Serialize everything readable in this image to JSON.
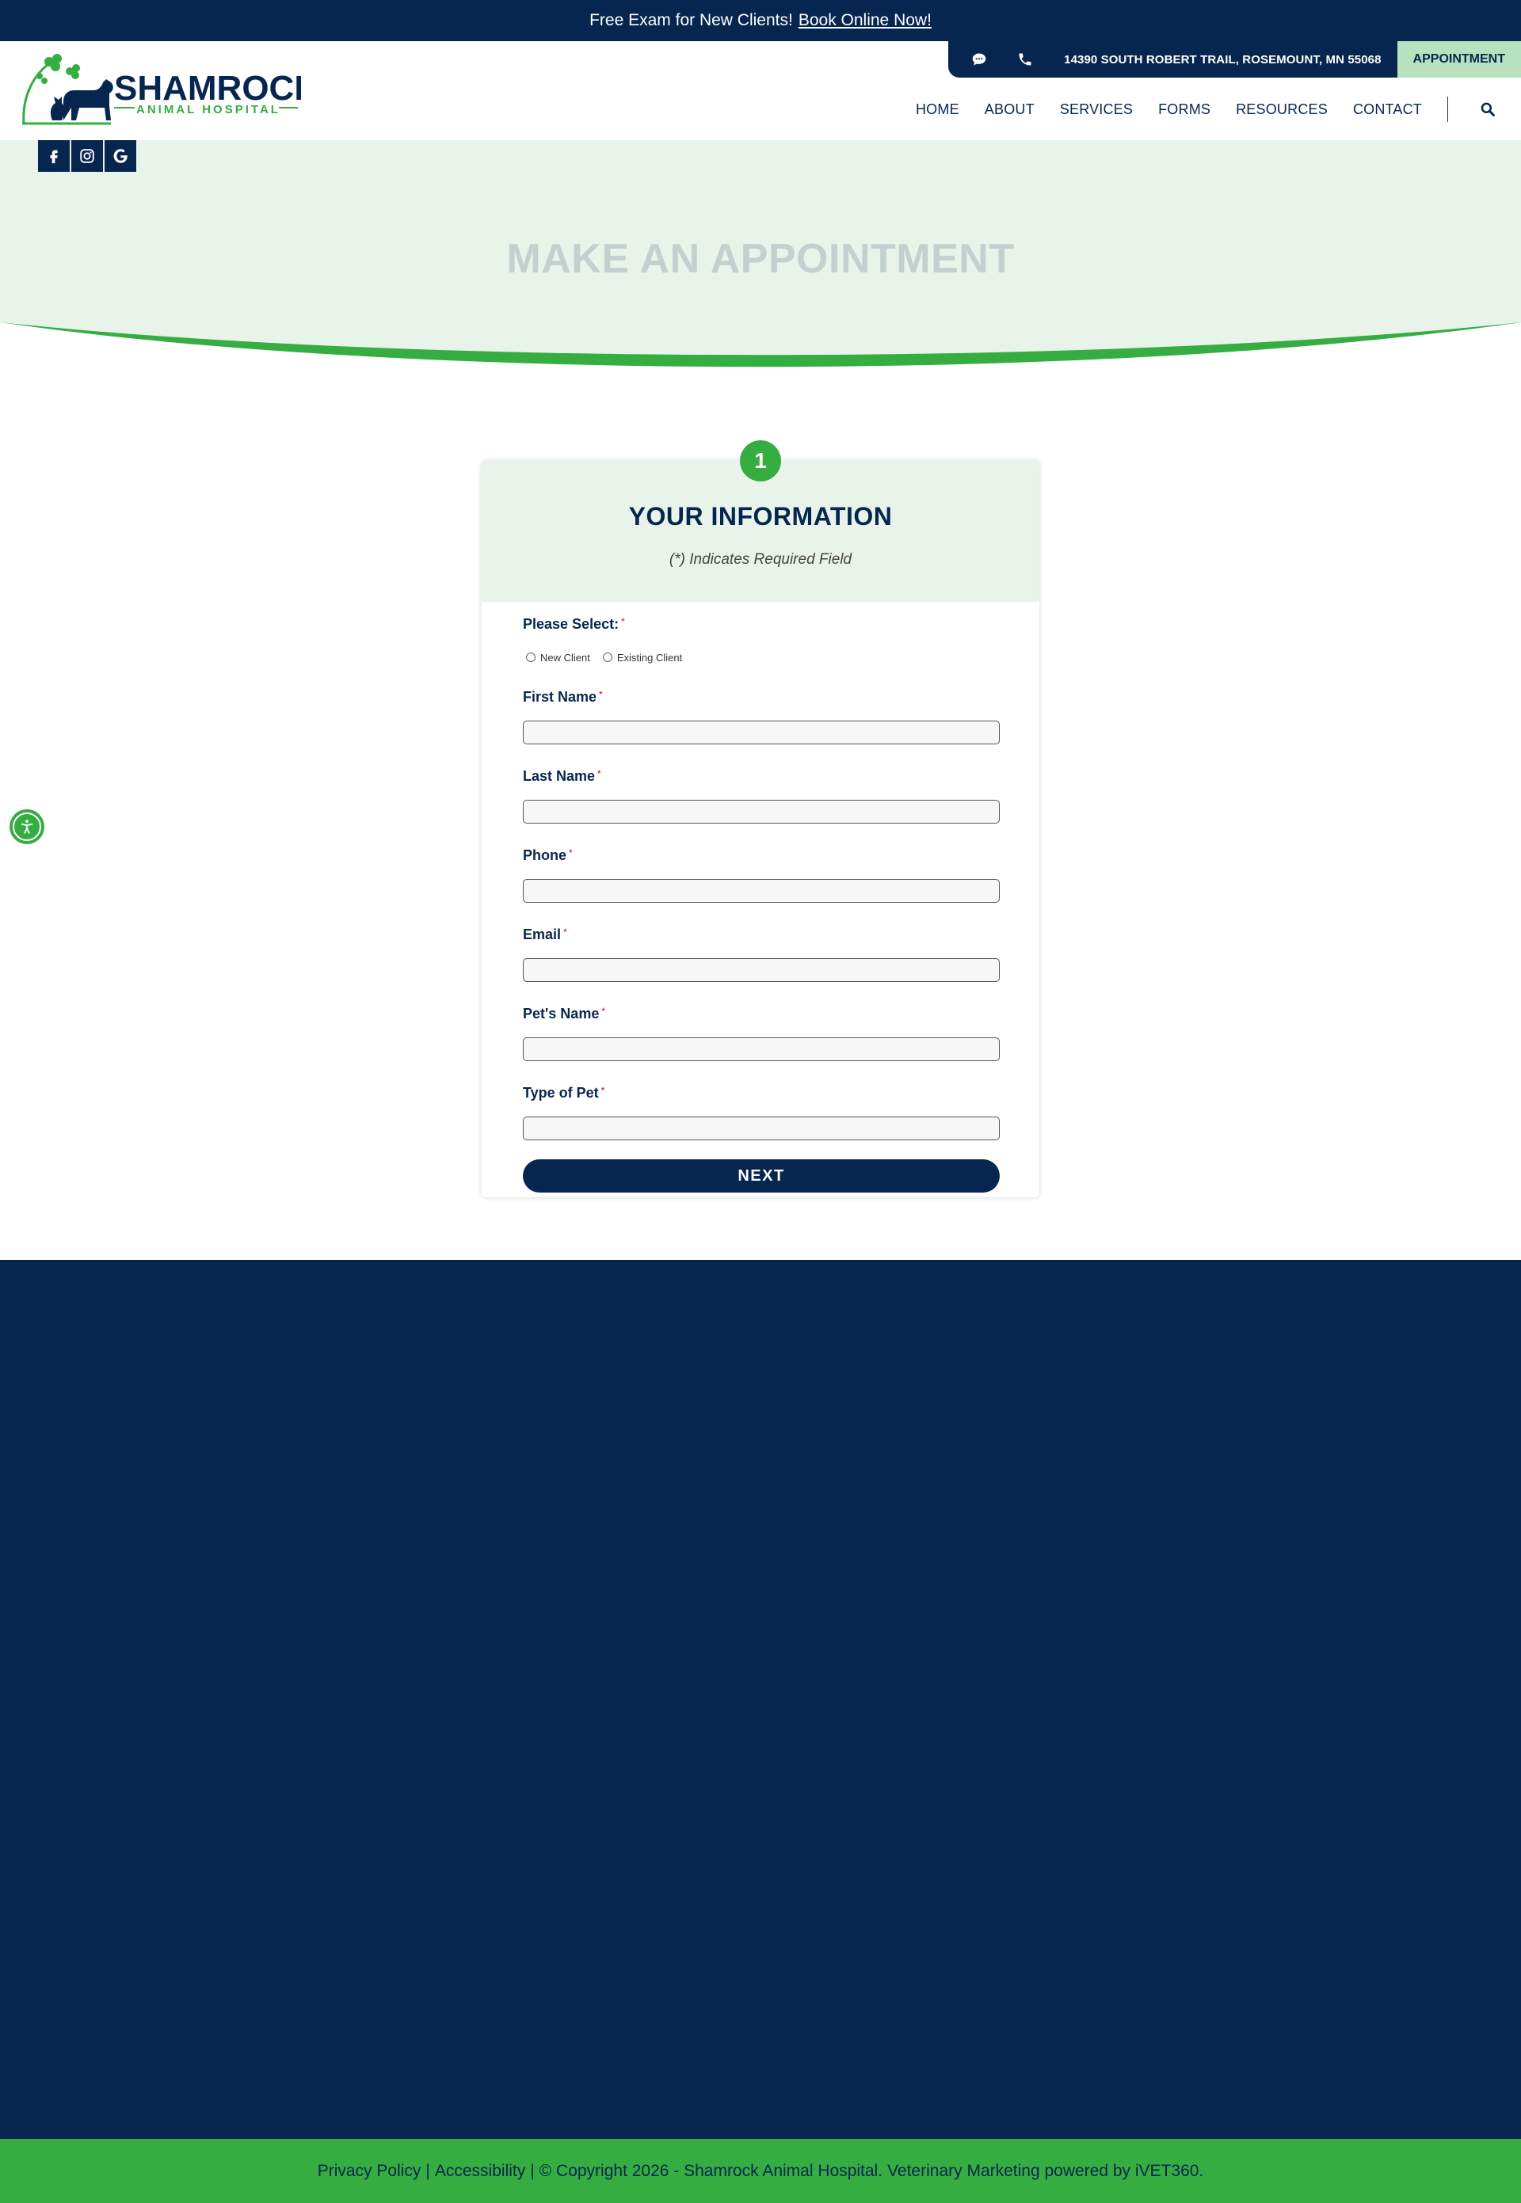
{
  "announcement": {
    "text": "Free Exam for New Clients!",
    "link": "Book Online Now!"
  },
  "header": {
    "logo": {
      "name": "SHAMROCK",
      "tagline": "ANIMAL HOSPITAL"
    },
    "topbar": {
      "chat_icon": "chat-bubble-icon",
      "phone_icon": "phone-icon",
      "address": "14390 SOUTH ROBERT TRAIL, ROSEMOUNT, MN 55068",
      "appointment": "APPOINTMENT"
    },
    "nav": [
      "HOME",
      "ABOUT",
      "SERVICES",
      "FORMS",
      "RESOURCES",
      "CONTACT"
    ],
    "search_icon": "search-icon"
  },
  "social": [
    "facebook-icon",
    "instagram-icon",
    "google-icon"
  ],
  "hero": {
    "title": "MAKE AN APPOINTMENT"
  },
  "form": {
    "step": "1",
    "title": "YOUR INFORMATION",
    "required_note": "(*) Indicates Required Field",
    "client_type": {
      "label": "Please Select:",
      "options": [
        "New Client",
        "Existing Client"
      ]
    },
    "fields": [
      {
        "label": "First Name",
        "value": ""
      },
      {
        "label": "Last Name",
        "value": ""
      },
      {
        "label": "Phone",
        "value": ""
      },
      {
        "label": "Email",
        "value": ""
      },
      {
        "label": "Pet's Name",
        "value": ""
      },
      {
        "label": "Type of Pet",
        "value": ""
      }
    ],
    "required_marker": "*",
    "submit": "NEXT"
  },
  "footer": {
    "privacy": "Privacy Policy",
    "divider": "|",
    "accessibility": "Accessibility",
    "copyright": "© Copyright 2026 - Shamrock Animal Hospital.",
    "credit": "Veterinary Marketing powered by iVET360."
  },
  "colors": {
    "navy": "#07264f",
    "green": "#36ad41",
    "light_green": "#e8f3ea",
    "appointment_bg": "#b8e2bf",
    "hero_title": "#c2d0d0"
  }
}
